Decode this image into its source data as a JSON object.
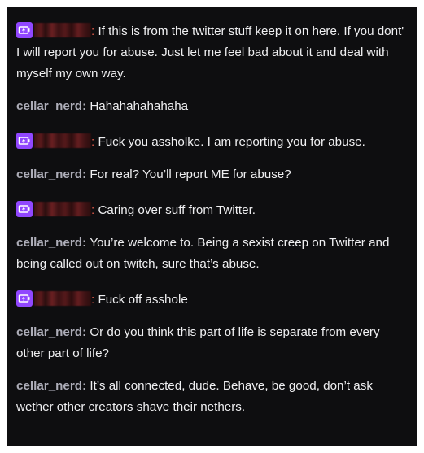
{
  "messages": [
    {
      "type": "redacted",
      "user": "",
      "text": "If this is from the twitter stuff keep it on here. If you dont' I will report you for abuse. Just let me feel bad about it and deal with myself my own way."
    },
    {
      "type": "named",
      "user": "cellar_nerd",
      "text": "Hahahahahahaha"
    },
    {
      "type": "redacted",
      "user": "",
      "text": "Fuck you assholke. I am reporting you for abuse."
    },
    {
      "type": "named",
      "user": "cellar_nerd",
      "text": "For real? You’ll report ME for abuse?"
    },
    {
      "type": "redacted",
      "user": "",
      "text": "Caring over suff from Twitter."
    },
    {
      "type": "named",
      "user": "cellar_nerd",
      "text": "You’re welcome to. Being a sexist creep on Twitter and being called out on twitch, sure that’s abuse."
    },
    {
      "type": "redacted",
      "user": "",
      "text": "Fuck off asshole"
    },
    {
      "type": "named",
      "user": "cellar_nerd",
      "text": "Or do you think this part of life is separate from every other part of life?"
    },
    {
      "type": "named",
      "user": "cellar_nerd",
      "text": "It’s all connected, dude. Behave, be good, don’t ask wether other creators shave their nethers."
    }
  ],
  "colors": {
    "background": "#0e0e10",
    "badge": "#9147ff",
    "username": "#adadb8",
    "redacted_colon": "#e05a4a",
    "text": "#efeff1"
  },
  "icons": {
    "badge_icon": "battery-bolt-icon"
  }
}
